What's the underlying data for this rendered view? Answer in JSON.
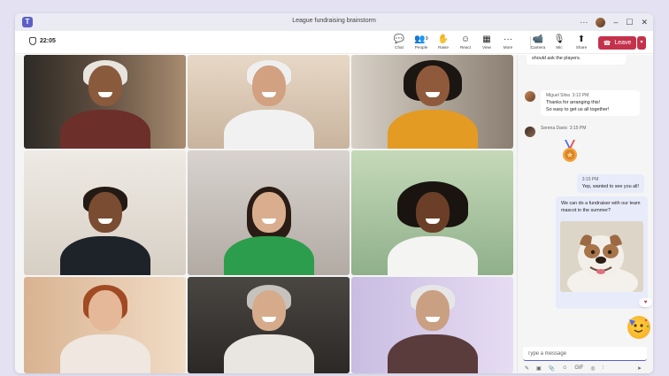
{
  "window": {
    "title": "League fundraising brainstorm",
    "more_glyph": "···"
  },
  "toolbar": {
    "timer": "22:05",
    "tools": [
      {
        "name": "chat",
        "glyph": "💬",
        "label": "Chat"
      },
      {
        "name": "people",
        "glyph": "👥",
        "label": "People"
      },
      {
        "name": "raise",
        "glyph": "✋",
        "label": "Raise"
      },
      {
        "name": "react",
        "glyph": "☺",
        "label": "React"
      },
      {
        "name": "view",
        "glyph": "▦",
        "label": "View"
      },
      {
        "name": "more",
        "glyph": "···",
        "label": "More"
      }
    ],
    "av_tools": [
      {
        "name": "camera",
        "glyph": "📹",
        "label": "Camera"
      },
      {
        "name": "mic",
        "glyph": "🎙",
        "label": "Mic"
      },
      {
        "name": "share",
        "glyph": "⬆",
        "label": "Share"
      }
    ],
    "people_count": "9",
    "leave_label": "Leave"
  },
  "chat": {
    "messages": [
      {
        "text": "should ask the players."
      },
      {
        "sender": "Miguel Silva",
        "time": "3:12 PM",
        "lines": [
          "Thanks for arranging this!",
          "So easy to get us all together!"
        ]
      },
      {
        "sender": "Serena Davis",
        "time": "3:15 PM"
      },
      {
        "time": "3:15 PM",
        "text": "Yep, wanted to see you all!"
      },
      {
        "text": "We can do a fundraiser with our team mascot in the summer?"
      }
    ],
    "compose_placeholder": "Type a message",
    "compose_tools": [
      "✎",
      "▣",
      "📎",
      "☺",
      "GIF",
      "◎",
      "⫶",
      "➤"
    ]
  },
  "colors": {
    "accent": "#5b5fc7",
    "leave": "#c4314b",
    "bubble_self": "#e8ebfa"
  }
}
